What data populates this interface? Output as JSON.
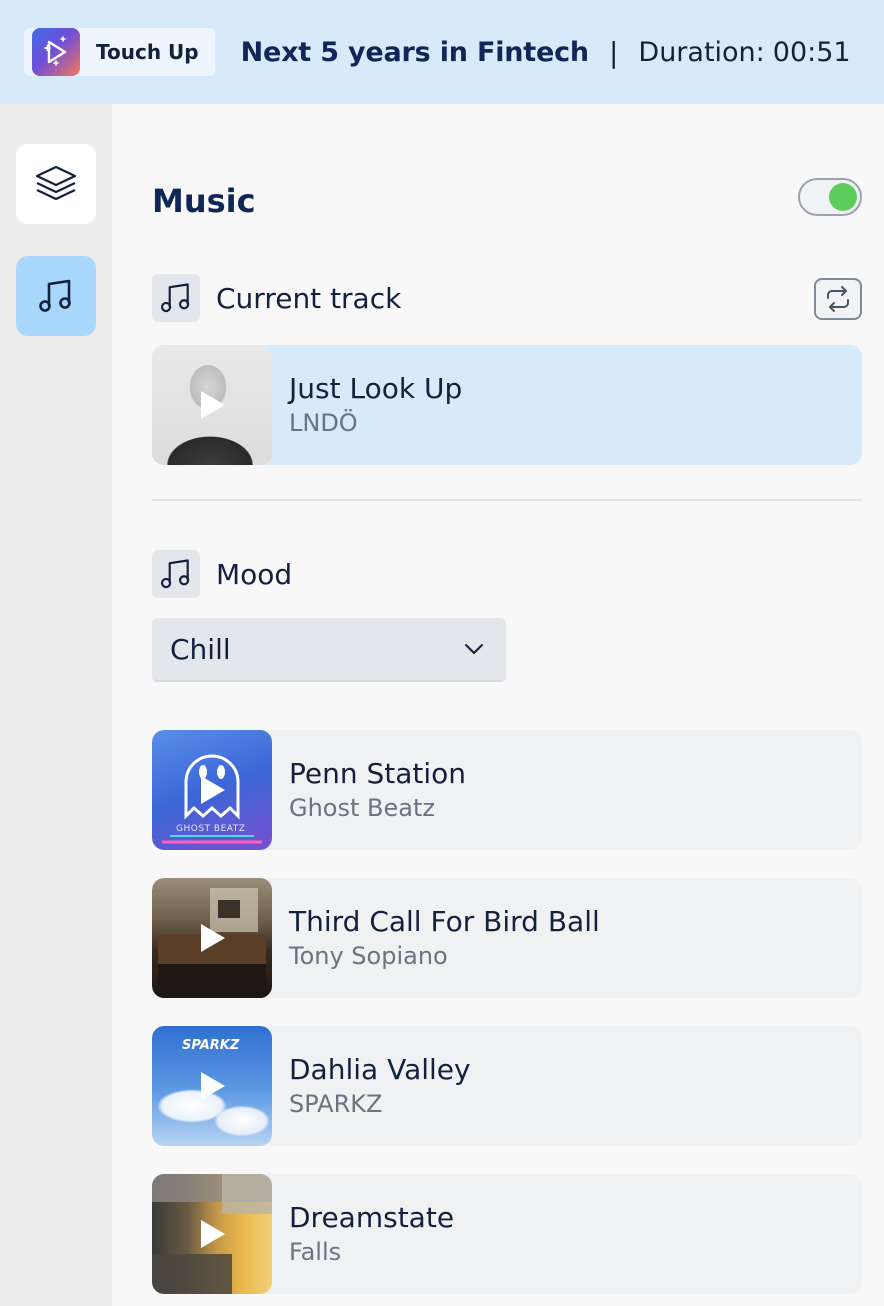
{
  "header": {
    "brand_name": "Touch Up",
    "doc_title": "Next 5 years in Fintech",
    "separator": "|",
    "duration_label": "Duration:",
    "duration_value": "00:51"
  },
  "sidebar": {
    "items": [
      {
        "name": "layers",
        "icon": "layers-icon",
        "active": false
      },
      {
        "name": "music",
        "icon": "music-note-icon",
        "active": true
      }
    ]
  },
  "music": {
    "title": "Music",
    "enabled": true,
    "current_track_label": "Current track",
    "current_track": {
      "title": "Just Look Up",
      "artist": "LNDÖ"
    },
    "mood_label": "Mood",
    "mood_value": "Chill",
    "tracks": [
      {
        "title": "Penn Station",
        "artist": "Ghost Beatz"
      },
      {
        "title": "Third Call For Bird Ball",
        "artist": "Tony Sopiano"
      },
      {
        "title": "Dahlia Valley",
        "artist": "SPARKZ"
      },
      {
        "title": "Dreamstate",
        "artist": "Falls"
      }
    ]
  },
  "artwork_text": {
    "ghost": "GHOST BEATZ",
    "sparkz": "SPARKZ"
  },
  "colors": {
    "header_bg": "#d6eafa",
    "accent_active": "#a9d6fb",
    "toggle_on": "#5ccc5a",
    "title_navy": "#0f2657"
  }
}
